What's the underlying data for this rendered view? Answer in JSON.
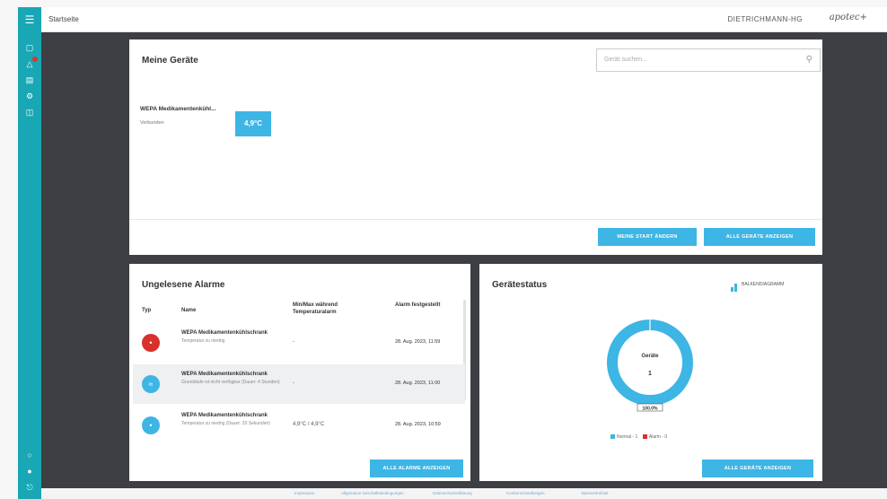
{
  "app": {
    "page_title": "Startseite",
    "user_name": "DIETRICHMANN-HG",
    "brand": "apotec+"
  },
  "sidebar": {
    "top_icons": [
      "monitor-icon",
      "alarm-icon",
      "report-icon",
      "settings-icon",
      "clipboard-icon"
    ],
    "bottom_icons": [
      "help-icon",
      "user-icon",
      "logout-icon"
    ]
  },
  "my_devices": {
    "title": "Meine Geräte",
    "search_placeholder": "Gerät suchen...",
    "device": {
      "name": "WEPA Medikamentenkühl...",
      "status": "Verbunden",
      "temperature": "4,9°C"
    },
    "button_start": "MEINE START ÄNDERN",
    "button_show_all": "ALLE GERÄTE ANZEIGEN"
  },
  "alarms": {
    "title": "Ungelesene Alarme",
    "headers": {
      "type": "Typ",
      "name": "Name",
      "minmax": "Min/Max während Temperaturalarm",
      "alarm_time": "Alarm festgestellt"
    },
    "rows": [
      {
        "icon": "thermometer-alarm-icon",
        "color": "#d9302c",
        "name": "WEPA Medikamentenkühlschrank",
        "desc": "Temperatur zu niedrig",
        "minmax": "-",
        "time": "28. Aug. 2023, 11:59"
      },
      {
        "icon": "connection-lost-icon",
        "color": "#3db5e5",
        "name": "WEPA Medikamentenkühlschrank",
        "desc": "Grundstufe ist nicht verfügbar (Dauer: 4 Stunden)",
        "minmax": "-",
        "time": "28. Aug. 2023, 11:00"
      },
      {
        "icon": "thermometer-info-icon",
        "color": "#3db5e5",
        "name": "WEPA Medikamentenkühlschrank",
        "desc": "Temperatur zu niedrig (Dauer: 33 Sekunden)",
        "minmax": "4,9°C / 4,9°C",
        "time": "28. Aug. 2023, 10:59"
      }
    ],
    "button_all": "ALLE ALARME ANZEIGEN"
  },
  "device_status": {
    "title": "Gerätestatus",
    "chart_toggle": "BALKENDIAGRAMM",
    "button_all": "ALLE GERÄTE ANZEIGEN",
    "colors": {
      "normal": "#3db5e5",
      "alarm": "#d9302c"
    }
  },
  "chart_data": {
    "type": "pie",
    "center_label": "Geräte",
    "center_value": "1",
    "slice_labels": [
      "100.0%"
    ],
    "categories": [
      "Normal",
      "Alarm"
    ],
    "values": [
      1,
      0
    ],
    "legend_texts": [
      "Normal - 1",
      "Alarm - 0"
    ]
  },
  "footer": {
    "links": [
      "Impressum",
      "Allgemeine Geschäftsbedingungen",
      "Datenschutzerklärung",
      "Cookie-Einstellungen",
      "Barrierefreiheit"
    ]
  }
}
